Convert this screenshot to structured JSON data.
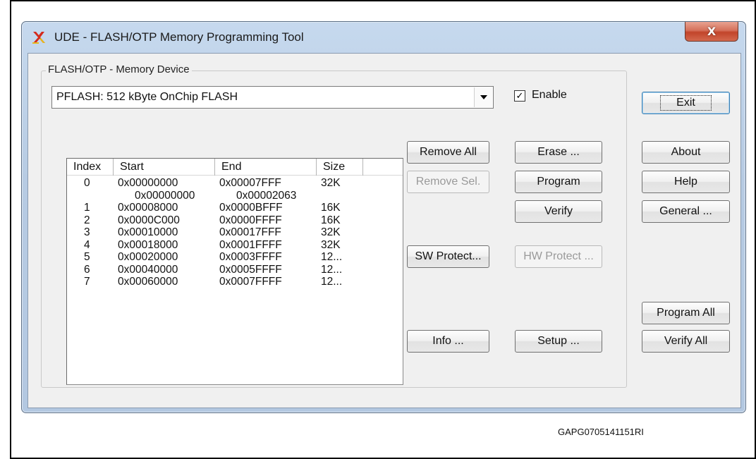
{
  "window": {
    "title": "UDE - FLASH/OTP Memory Programming Tool",
    "close_glyph": "X"
  },
  "device_group": {
    "label": "FLASH/OTP - Memory Device",
    "selected_device": "PFLASH: 512 kByte OnChip FLASH",
    "enable_label": "Enable",
    "enable_checked": true
  },
  "sectors": {
    "columns": [
      "Index",
      "Start",
      "End",
      "Size"
    ],
    "rows": [
      {
        "index": "0",
        "start": "0x00000000",
        "end": "0x00007FFF",
        "size": "32K"
      },
      {
        "index": "",
        "start": "0x00000000",
        "end": "0x00002063",
        "size": ""
      },
      {
        "index": "1",
        "start": "0x00008000",
        "end": "0x0000BFFF",
        "size": "16K"
      },
      {
        "index": "2",
        "start": "0x0000C000",
        "end": "0x0000FFFF",
        "size": "16K"
      },
      {
        "index": "3",
        "start": "0x00010000",
        "end": "0x00017FFF",
        "size": "32K"
      },
      {
        "index": "4",
        "start": "0x00018000",
        "end": "0x0001FFFF",
        "size": "32K"
      },
      {
        "index": "5",
        "start": "0x00020000",
        "end": "0x0003FFFF",
        "size": "12..."
      },
      {
        "index": "6",
        "start": "0x00040000",
        "end": "0x0005FFFF",
        "size": "12..."
      },
      {
        "index": "7",
        "start": "0x00060000",
        "end": "0x0007FFFF",
        "size": "12..."
      }
    ]
  },
  "buttons": {
    "remove_all": "Remove All",
    "remove_sel": "Remove Sel.",
    "sw_protect": "SW Protect...",
    "info": "Info ...",
    "erase": "Erase ...",
    "program": "Program",
    "verify": "Verify",
    "hw_protect": "HW Protect ...",
    "setup": "Setup ...",
    "exit": "Exit",
    "about": "About",
    "help": "Help",
    "general": "General ...",
    "program_all": "Program All",
    "verify_all": "Verify All"
  },
  "figure_code": "GAPG0705141151RI",
  "colors": {
    "title_bar": "#b7cbe3",
    "close_button": "#c2442a",
    "dialog_bg": "#f0f0f0",
    "disabled_text": "#9a9a9a"
  },
  "icons": {
    "app": "ude-app-icon",
    "close": "close-icon",
    "dropdown": "chevron-down-icon",
    "check": "checkmark-icon"
  }
}
